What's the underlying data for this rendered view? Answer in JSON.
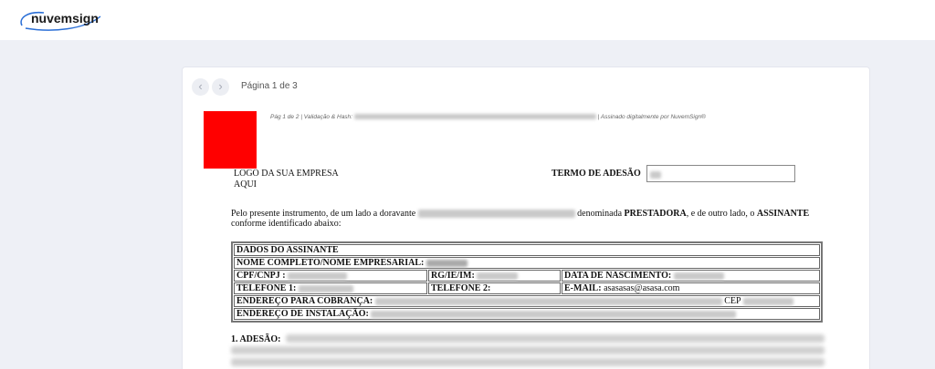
{
  "app": {
    "name": "nuvemsign",
    "colors": {
      "logo_text": "#1a1a1a",
      "logo_swoosh": "#2b6fd6",
      "background": "#eef0f6",
      "logo_placeholder": "#ff0000"
    }
  },
  "viewer": {
    "page_indicator": "Página 1 de 3",
    "prev_icon": "chevron-left-icon",
    "next_icon": "chevron-right-icon"
  },
  "document": {
    "hash_prefix": "Pág 1 de 2 | Validação & Hash:",
    "hash_suffix": "| Assinado digitalmente por NuvemSign®",
    "logo_text": "LOGO DA SUA EMPRESA AQUI",
    "term_label": "TERMO DE ADESÃO",
    "intro": {
      "part1": "Pelo presente instrumento, de um lado a doravante",
      "part2": "denominada",
      "prestadora": "PRESTADORA",
      "part3": ", e de outro lado, o",
      "assinante": "ASSINANTE",
      "part4": "conforme identificado abaixo:"
    },
    "table": {
      "header": "DADOS DO ASSINANTE",
      "nome_label": "NOME COMPLETO/NOME EMPRESARIAL:",
      "cpf_label": "CPF/CNPJ :",
      "rg_label": "RG/IE/IM:",
      "nascimento_label": "DATA DE NASCIMENTO:",
      "telefone1_label": "TELEFONE 1:",
      "telefone2_label": "TELEFONE 2:",
      "email_label": "E-MAIL:",
      "email_value": "asasasas@asasa.com",
      "cobranca_label": "ENDEREÇO PARA COBRANÇA:",
      "cep_label": "CEP",
      "instalacao_label": "ENDEREÇO DE INSTALAÇÃO:"
    },
    "section1_title": "1. ADESÃO:"
  }
}
